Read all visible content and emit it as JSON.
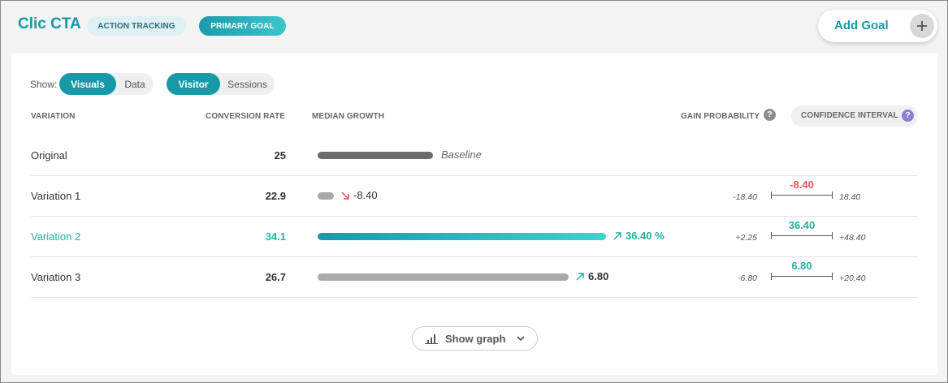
{
  "header": {
    "title": "Clic CTA",
    "tags": [
      "ACTION TRACKING",
      "PRIMARY GOAL"
    ],
    "add_goal_label": "Add Goal",
    "add_goal_icon": "plus-icon"
  },
  "controls": {
    "show_label": "Show:",
    "view_toggle": {
      "options": [
        "Visuals",
        "Data"
      ],
      "selected": "Visuals"
    },
    "unit_toggle": {
      "options": [
        "Visitor",
        "Sessions"
      ],
      "selected": "Visitor"
    }
  },
  "columns": {
    "variation": "VARIATION",
    "conversion_rate": "CONVERSION RATE",
    "median_growth": "MEDIAN GROWTH",
    "gain_probability": "GAIN PROBABILITY",
    "confidence_interval": "CONFIDENCE INTERVAL"
  },
  "rows": [
    {
      "name": "Original",
      "rate": "25",
      "growth_label": "Baseline",
      "growth_value": 0,
      "ci_low": "",
      "ci_high": "",
      "ci_value": ""
    },
    {
      "name": "Variation 1",
      "rate": "22.9",
      "growth_label": "-8.40",
      "growth_value": -8.4,
      "ci_low": "-18.40",
      "ci_high": "18.40",
      "ci_value": "-8.40"
    },
    {
      "name": "Variation 2",
      "rate": "34.1",
      "growth_label": "36.40 %",
      "growth_value": 36.4,
      "ci_low": "+2.25",
      "ci_high": "+48.40",
      "ci_value": "36.40"
    },
    {
      "name": "Variation 3",
      "rate": "26.7",
      "growth_label": "6.80",
      "growth_value": 6.8,
      "ci_low": "-6.80",
      "ci_high": "+20.40",
      "ci_value": "6.80"
    }
  ],
  "footer": {
    "show_graph_label": "Show graph",
    "graph_icon": "bar-chart-icon",
    "chevron_icon": "chevron-down-icon"
  },
  "colors": {
    "accent": "#1899a8",
    "positive": "#21b39e",
    "negative": "#e8505b",
    "neutral_bar": "#a9a9a9",
    "baseline_bar": "#6b6b6b"
  }
}
